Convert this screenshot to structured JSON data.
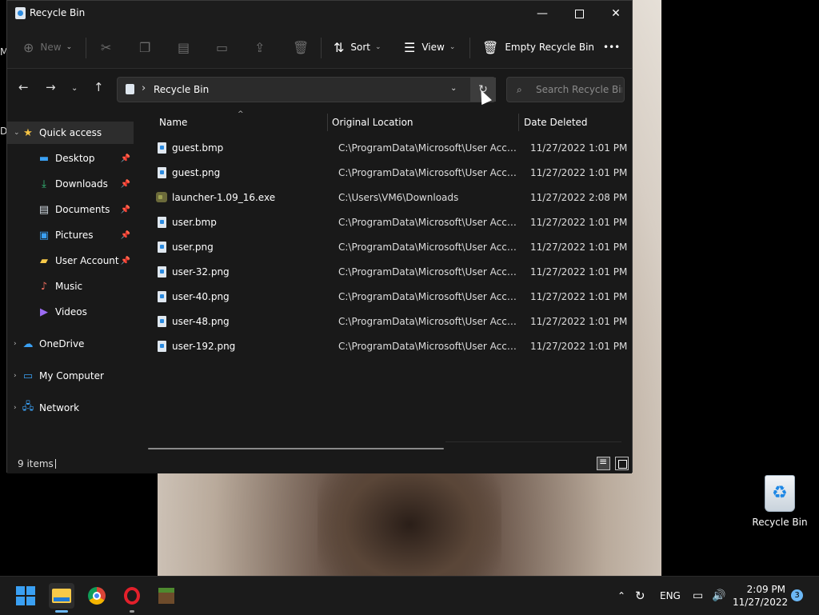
{
  "window": {
    "title": "Recycle Bin",
    "controls": {
      "minimize": "—",
      "close": "✕"
    }
  },
  "toolbar": {
    "new_label": "New",
    "sort_label": "Sort",
    "view_label": "View",
    "empty_label": "Empty Recycle Bin",
    "more_label": "•••"
  },
  "nav": {
    "address": "Recycle Bin",
    "search_placeholder": "Search Recycle Bin"
  },
  "sidebar": {
    "items": [
      {
        "label": "Quick access",
        "icon": "star-icon"
      },
      {
        "label": "Desktop",
        "icon": "desktop-icon"
      },
      {
        "label": "Downloads",
        "icon": "download-icon"
      },
      {
        "label": "Documents",
        "icon": "document-icon"
      },
      {
        "label": "Pictures",
        "icon": "picture-icon"
      },
      {
        "label": "User Account P",
        "icon": "folder-icon"
      },
      {
        "label": "Music",
        "icon": "music-icon"
      },
      {
        "label": "Videos",
        "icon": "video-icon"
      },
      {
        "label": "OneDrive",
        "icon": "cloud-icon"
      },
      {
        "label": "My Computer",
        "icon": "computer-icon"
      },
      {
        "label": "Network",
        "icon": "network-icon"
      }
    ]
  },
  "columns": {
    "name": "Name",
    "location": "Original Location",
    "date": "Date Deleted"
  },
  "files": [
    {
      "name": "guest.bmp",
      "location": "C:\\ProgramData\\Microsoft\\User Accoun...",
      "date": "11/27/2022 1:01 PM"
    },
    {
      "name": "guest.png",
      "location": "C:\\ProgramData\\Microsoft\\User Accoun...",
      "date": "11/27/2022 1:01 PM"
    },
    {
      "name": "launcher-1.09_16.exe",
      "location": "C:\\Users\\VM6\\Downloads",
      "date": "11/27/2022 2:08 PM"
    },
    {
      "name": "user.bmp",
      "location": "C:\\ProgramData\\Microsoft\\User Accoun...",
      "date": "11/27/2022 1:01 PM"
    },
    {
      "name": "user.png",
      "location": "C:\\ProgramData\\Microsoft\\User Accoun...",
      "date": "11/27/2022 1:01 PM"
    },
    {
      "name": "user-32.png",
      "location": "C:\\ProgramData\\Microsoft\\User Accoun...",
      "date": "11/27/2022 1:01 PM"
    },
    {
      "name": "user-40.png",
      "location": "C:\\ProgramData\\Microsoft\\User Accoun...",
      "date": "11/27/2022 1:01 PM"
    },
    {
      "name": "user-48.png",
      "location": "C:\\ProgramData\\Microsoft\\User Accoun...",
      "date": "11/27/2022 1:01 PM"
    },
    {
      "name": "user-192.png",
      "location": "C:\\ProgramData\\Microsoft\\User Accoun...",
      "date": "11/27/2022 1:01 PM"
    }
  ],
  "status": {
    "count": "9 items"
  },
  "desktop": {
    "recycle_label": "Recycle Bin",
    "partial_labels": [
      "M",
      "D"
    ]
  },
  "taskbar": {
    "lang": "ENG",
    "time": "2:09 PM",
    "date": "11/27/2022",
    "notifications": "3"
  },
  "colors": {
    "accent": "#3aa0f3",
    "window_bg": "#191919"
  }
}
